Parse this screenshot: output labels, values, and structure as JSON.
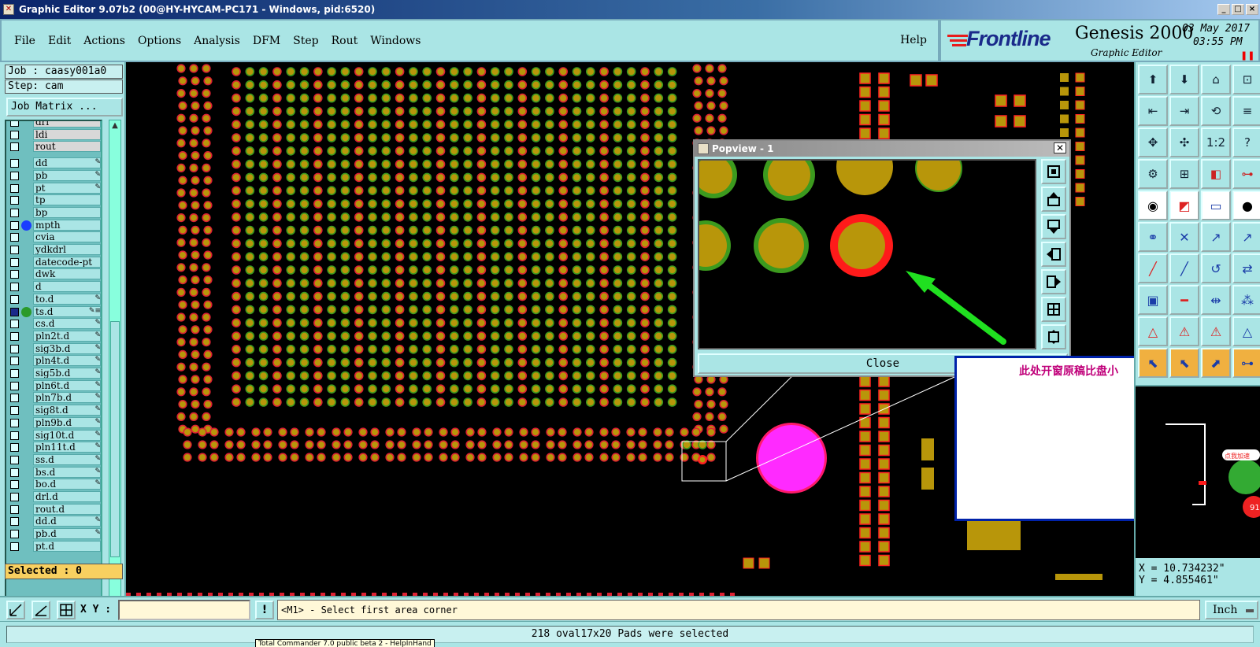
{
  "window": {
    "title": "Graphic Editor 9.07b2 (00@HY-HYCAM-PC171 - Windows, pid:6520)"
  },
  "menu": {
    "items": [
      "File",
      "Edit",
      "Actions",
      "Options",
      "Analysis",
      "DFM",
      "Step",
      "Rout",
      "Windows"
    ],
    "help": "Help"
  },
  "brand": {
    "logo": "Frontline",
    "product": "Genesis 2000",
    "subtitle": "Graphic Editor",
    "date": "03 May 2017",
    "time": "03:55 PM"
  },
  "job_panel": {
    "job": "Job : caasy001a0",
    "step": "Step: cam",
    "job_matrix_button": "Job Matrix ...",
    "selected": "Selected : 0"
  },
  "layers": [
    {
      "name": "drl",
      "style": "grey"
    },
    {
      "name": "ldi",
      "style": "grey"
    },
    {
      "name": "rout",
      "style": "grey"
    },
    {
      "name": "dd",
      "flag": "✎"
    },
    {
      "name": "pb",
      "flag": "✎"
    },
    {
      "name": "pt",
      "flag": "✎"
    },
    {
      "name": "tp"
    },
    {
      "name": "bp"
    },
    {
      "name": "mpth",
      "dot": "#1a3cff"
    },
    {
      "name": "cvia"
    },
    {
      "name": "ydkdrl"
    },
    {
      "name": "datecode-pt"
    },
    {
      "name": "dwk"
    },
    {
      "name": "d"
    },
    {
      "name": "to.d",
      "flag": "✎"
    },
    {
      "name": "ts.d",
      "dot": "#2a9a2a",
      "flag": "✎≡",
      "checked": true
    },
    {
      "name": "cs.d",
      "flag": "✎"
    },
    {
      "name": "pln2t.d",
      "flag": "✎"
    },
    {
      "name": "sig3b.d",
      "flag": "✎"
    },
    {
      "name": "pln4t.d",
      "flag": "✎"
    },
    {
      "name": "sig5b.d",
      "flag": "✎"
    },
    {
      "name": "pln6t.d",
      "flag": "✎"
    },
    {
      "name": "pln7b.d",
      "flag": "✎"
    },
    {
      "name": "sig8t.d",
      "flag": "✎"
    },
    {
      "name": "pln9b.d",
      "flag": "✎"
    },
    {
      "name": "sig10t.d",
      "flag": "✎"
    },
    {
      "name": "pln11t.d",
      "flag": "✎"
    },
    {
      "name": "ss.d",
      "flag": "✎"
    },
    {
      "name": "bs.d",
      "flag": "✎"
    },
    {
      "name": "bo.d",
      "flag": "✎"
    },
    {
      "name": "drl.d"
    },
    {
      "name": "rout.d"
    },
    {
      "name": "dd.d",
      "flag": "✎"
    },
    {
      "name": "pb.d",
      "flag": "✎"
    },
    {
      "name": "pt.d"
    }
  ],
  "popview": {
    "title": "Popview - 1",
    "close_label": "Close"
  },
  "annotation": {
    "text": "此处开窗原稿比盘小"
  },
  "coords": {
    "x": "X = 10.734232\"",
    "y": "Y = 4.855461\""
  },
  "command": {
    "xy_label": "X Y :",
    "xy_value": "",
    "warn": "!",
    "prompt": "<M1> - Select first area corner",
    "units": "Inch"
  },
  "status": {
    "message": "218 oval17x20 Pads were selected",
    "tooltip": "Total Commander 7.0 public beta 2 - HelpInHand"
  },
  "colors": {
    "pad_fill": "#b8960a",
    "pad_ring_green": "#3c9a1e",
    "pad_ring_red": "#ff1a1a",
    "highlight_pad": "#ff2aff",
    "arrow": "#20e020",
    "panel_bg": "#aae5e5",
    "annotation_text": "#c0007a"
  },
  "icons": [
    "frontline-logo-icon",
    "layer-checkbox-icon",
    "zoom-icon",
    "pan-icon",
    "measure-icon",
    "select-icon",
    "snap-icon",
    "arrow-icon"
  ]
}
